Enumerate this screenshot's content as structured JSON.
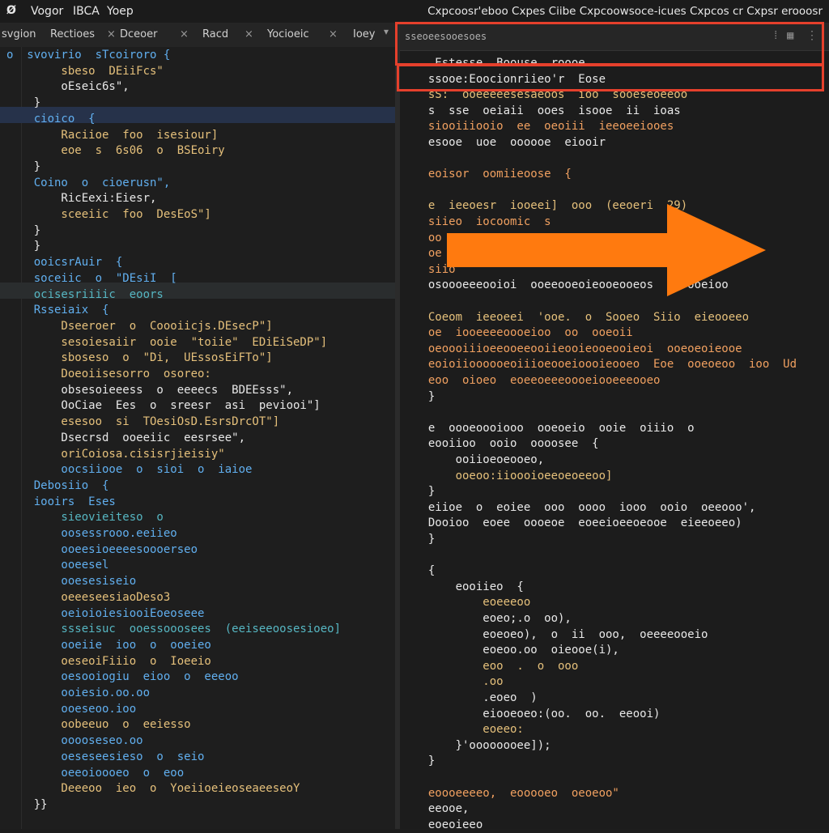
{
  "app": {
    "logo": "Ø",
    "menus": [
      "Vogor",
      "IBCA",
      "Yoep"
    ],
    "window_title": "Cxpcoosr'eboo  Cxpes Ciibe Cxpcoowsoce-icues  Cxpcos  cr Cxpsr erooosr"
  },
  "tabs": [
    {
      "label": "svgion"
    },
    {
      "label": "Rectioes",
      "close": "×"
    },
    {
      "label": "Dceoer",
      "close": "×"
    },
    {
      "label": "Racd",
      "close": "×"
    },
    {
      "label": "Yocioeic",
      "close": "×"
    },
    {
      "label": "Ioey",
      "close": "×"
    }
  ],
  "left_code": [
    {
      "text": "o  svovirio  sTcoiroro {",
      "color": "id"
    },
    {
      "text": "        sbeso  DEiiFcs\"",
      "color": "str"
    },
    {
      "text": "        oEseic6s\",",
      "color": "wh"
    },
    {
      "text": "    }",
      "color": "wh"
    },
    {
      "text": "    cioico  {",
      "color": "id"
    },
    {
      "text": "        Raciioe  foo  isesiour]",
      "color": "str"
    },
    {
      "text": "        eoe  s  6s06  o  BSEoiry",
      "color": "str"
    },
    {
      "text": "    }",
      "color": "wh"
    },
    {
      "text": "    Coino  o  cioerusn\",",
      "color": "id"
    },
    {
      "text": "        RicEexi:Eiesr,",
      "color": "wh"
    },
    {
      "text": "        sceeiic  foo  DesEoS\"]",
      "color": "str"
    },
    {
      "text": "    }",
      "color": "wh"
    },
    {
      "text": "    }",
      "color": "wh"
    },
    {
      "text": "    ooicsrAuir  {",
      "color": "id"
    },
    {
      "text": "    soceiic  o  \"DEsiI  [",
      "color": "id"
    },
    {
      "text": "    ocisesriiiic  eoors",
      "color": "fn"
    },
    {
      "text": "    Rsseiaix  {",
      "color": "id"
    },
    {
      "text": "        Dseeroer  o  Coooiicjs.DEsecP\"]",
      "color": "str"
    },
    {
      "text": "        sesoiesaiir  ooie  \"toiie\"  EDiEiSeDP\"]",
      "color": "str"
    },
    {
      "text": "        sboseso  o  \"Di,  UEssosEiFTo\"]",
      "color": "str"
    },
    {
      "text": "        Doeoiisesorro  osoreo:",
      "color": "str"
    },
    {
      "text": "        obsesoieeess  o  eeeecs  BDEEsss\",",
      "color": "wh"
    },
    {
      "text": "        OoCiae  Ees  o  sreesr  asi  peviooi\"]",
      "color": "wh"
    },
    {
      "text": "        esesoo  si  TOesiOsD.EsrsDrcOT\"]",
      "color": "str"
    },
    {
      "text": "        Dsecrsd  ooeeiic  eesrsee\",",
      "color": "wh"
    },
    {
      "text": "        oriCoiosa.cisisrjieisiy\"",
      "color": "str"
    },
    {
      "text": "        oocsiiooe  o  sioi  o  iaioe",
      "color": "id"
    },
    {
      "text": "    Debosiio  {",
      "color": "id"
    },
    {
      "text": "    iooirs  Eses",
      "color": "id"
    },
    {
      "text": "        sieovieiteso  o",
      "color": "fn"
    },
    {
      "text": "        oosessrooo.eeiieo",
      "color": "id"
    },
    {
      "text": "        ooeesioeeeesoooerseo",
      "color": "id"
    },
    {
      "text": "        ooeesel",
      "color": "id"
    },
    {
      "text": "        ooesesiseio",
      "color": "id"
    },
    {
      "text": "        oeeeseesiaoDeso3",
      "color": "str"
    },
    {
      "text": "        oeioioiesiooiEoeoseee",
      "color": "id"
    },
    {
      "text": "        ssseisuc  ooessooosees  (eeiseeoosesioeo]",
      "color": "fn"
    },
    {
      "text": "        ooeiie  ioo  o  ooeieo",
      "color": "id"
    },
    {
      "text": "        oeseoiFiiio  o  Ioeeio",
      "color": "str"
    },
    {
      "text": "        oesooiogiu  eioo  o  eeeoo",
      "color": "id"
    },
    {
      "text": "        ooiesio.oo.oo",
      "color": "id"
    },
    {
      "text": "        ooeseoo.ioo",
      "color": "id"
    },
    {
      "text": "        oobeeuo  o  eeiesso",
      "color": "str"
    },
    {
      "text": "        ooooseseo.oo",
      "color": "id"
    },
    {
      "text": "        oeseseesieso  o  seio",
      "color": "id"
    },
    {
      "text": "        oeeoioooeo  o  eoo",
      "color": "id"
    },
    {
      "text": "        Deeeoo  ieo  o  YoeiioeieoseaeeseoY",
      "color": "str"
    },
    {
      "text": "    }}",
      "color": "wh"
    }
  ],
  "right_panel": {
    "path": "sseoeesooesoes",
    "toolbar_icons": [
      "split-icon",
      "more-icon",
      "grid-icon"
    ],
    "toolbar_glyphs": [
      "⁞",
      "▦",
      "⋮⋮"
    ]
  },
  "right_code": [
    {
      "text": "   Estesse  Boouse  roooe",
      "color": "wh"
    },
    {
      "text": "  ssooe:Eoocionriieo'r  Eose",
      "color": "wh"
    },
    {
      "text": "  sS:  ooeeeeesesaeoos  ioo  sooeseoeeoo",
      "color": "str"
    },
    {
      "text": "  s  sse  oeiaii  ooes  isooe  ii  ioas",
      "color": "wh"
    },
    {
      "text": "  siooiiiooio  ee  oeoiii  ieeoeeiooes",
      "color": "org"
    },
    {
      "text": "  esooe  uoe  oooooe  eiooir",
      "color": "wh"
    },
    {
      "text": "",
      "color": "wh"
    },
    {
      "text": "  eoisor  oomiieoose  {",
      "color": "org"
    },
    {
      "text": "",
      "color": "wh"
    },
    {
      "text": "  e  ieeoesr  iooeei]  ooo  (eeoeri  29)",
      "color": "str"
    },
    {
      "text": "  siieo  iocoomic  s",
      "color": "org"
    },
    {
      "text": "  oo",
      "color": "org"
    },
    {
      "text": "  oe",
      "color": "org"
    },
    {
      "text": "  siio",
      "color": "org"
    },
    {
      "text": "  osoooeeeooioi  ooeeooeoieooeooeos  o  ooeioo",
      "color": "wh"
    },
    {
      "text": "",
      "color": "wh"
    },
    {
      "text": "  Coeom  ieeoeei  'ooe.  o  Sooeo  Siio  eieooeeo",
      "color": "str"
    },
    {
      "text": "  oe  iooeeeeoooeioo  oo  ooeoii",
      "color": "org"
    },
    {
      "text": "  oeoooiiioeeooeeooiieooieooeooieoi  ooeoeoieooe",
      "color": "org"
    },
    {
      "text": "  eoioiioooooeoiiioeooeioooieooeo  Eoe  ooeoeoo  ioo  Ud",
      "color": "org"
    },
    {
      "text": "  eoo  oioeo  eoeeoeeeoooeiooeeeooeo",
      "color": "org"
    },
    {
      "text": "  }",
      "color": "wh"
    },
    {
      "text": "",
      "color": "wh"
    },
    {
      "text": "  e  oooeoooiooo  ooeoeio  ooie  oiiio  o",
      "color": "wh"
    },
    {
      "text": "  eooiioo  ooio  oooosee  {",
      "color": "wh"
    },
    {
      "text": "      ooiioeoeooeo,",
      "color": "wh"
    },
    {
      "text": "      ooeoo:iioooioeeoeoeeoo]",
      "color": "str"
    },
    {
      "text": "  }",
      "color": "wh"
    },
    {
      "text": "  eiioe  o  eoiee  ooo  oooo  iooo  ooio  oeeooo',",
      "color": "wh"
    },
    {
      "text": "  Dooioo  eoee  oooeoe  eoeeioeeoeooe  eieeoeeo)",
      "color": "wh"
    },
    {
      "text": "  }",
      "color": "wh"
    },
    {
      "text": "",
      "color": "wh"
    },
    {
      "text": "  {",
      "color": "wh"
    },
    {
      "text": "      eooiieo  {",
      "color": "wh"
    },
    {
      "text": "          eoeeeoo",
      "color": "str"
    },
    {
      "text": "          eoeo;.o  oo),",
      "color": "wh"
    },
    {
      "text": "          eoeoeo),  o  ii  ooo,  oeeeeooeio",
      "color": "wh"
    },
    {
      "text": "          eoeoo.oo  oieooe(i),",
      "color": "wh"
    },
    {
      "text": "          eoo  .  o  ooo",
      "color": "str"
    },
    {
      "text": "          .oo",
      "color": "str"
    },
    {
      "text": "          .eoeo  )",
      "color": "wh"
    },
    {
      "text": "          eiooeoeo:(oo.  oo.  eeooi)",
      "color": "wh"
    },
    {
      "text": "          eoeeo:",
      "color": "str"
    },
    {
      "text": "      }'oooooooee]);",
      "color": "wh"
    },
    {
      "text": "  }",
      "color": "wh"
    },
    {
      "text": "",
      "color": "wh"
    },
    {
      "text": "  eoooeeeeo,  eooooeo  oeoeoo\"",
      "color": "org"
    },
    {
      "text": "  eeooe,",
      "color": "wh"
    },
    {
      "text": "  eoeoieeo",
      "color": "wh"
    }
  ]
}
